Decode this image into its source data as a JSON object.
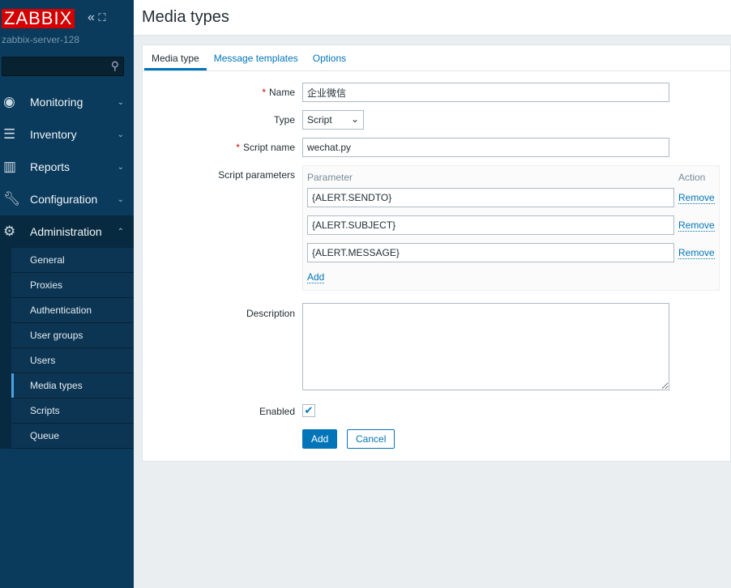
{
  "sidebar": {
    "logo": "ZABBIX",
    "host": "zabbix-server-128",
    "search_placeholder": "",
    "menu": [
      {
        "label": "Monitoring",
        "icon": "eye-icon"
      },
      {
        "label": "Inventory",
        "icon": "list-icon"
      },
      {
        "label": "Reports",
        "icon": "bar-chart-icon"
      },
      {
        "label": "Configuration",
        "icon": "wrench-icon"
      },
      {
        "label": "Administration",
        "icon": "gear-icon"
      }
    ],
    "submenu": [
      "General",
      "Proxies",
      "Authentication",
      "User groups",
      "Users",
      "Media types",
      "Scripts",
      "Queue"
    ]
  },
  "header": {
    "title": "Media types"
  },
  "tabs": [
    "Media type",
    "Message templates",
    "Options"
  ],
  "form": {
    "name_label": "Name",
    "name_value": "企业微信",
    "type_label": "Type",
    "type_value": "Script",
    "script_name_label": "Script name",
    "script_name_value": "wechat.py",
    "params_label": "Script parameters",
    "param_col": "Parameter",
    "action_col": "Action",
    "params": [
      "{ALERT.SENDTO}",
      "{ALERT.SUBJECT}",
      "{ALERT.MESSAGE}"
    ],
    "remove": "Remove",
    "add_param": "Add",
    "description_label": "Description",
    "description_value": "",
    "enabled_label": "Enabled",
    "enabled": true,
    "add_button": "Add",
    "cancel_button": "Cancel"
  }
}
